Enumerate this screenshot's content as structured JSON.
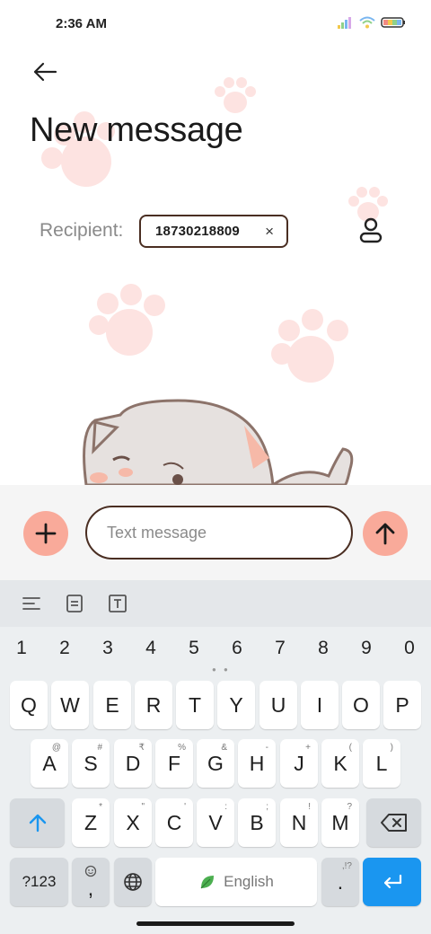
{
  "status": {
    "time": "2:36 AM"
  },
  "header": {
    "title": "New message"
  },
  "recipient": {
    "label": "Recipient:",
    "number": "18730218809",
    "remove": "×"
  },
  "compose": {
    "placeholder": "Text message"
  },
  "keyboard": {
    "numbers": [
      "1",
      "2",
      "3",
      "4",
      "5",
      "6",
      "7",
      "8",
      "9",
      "0"
    ],
    "row1": [
      "Q",
      "W",
      "E",
      "R",
      "T",
      "Y",
      "U",
      "I",
      "O",
      "P"
    ],
    "row2": [
      {
        "k": "A",
        "s": "@"
      },
      {
        "k": "S",
        "s": "#"
      },
      {
        "k": "D",
        "s": "₹"
      },
      {
        "k": "F",
        "s": "%"
      },
      {
        "k": "G",
        "s": "&"
      },
      {
        "k": "H",
        "s": "-"
      },
      {
        "k": "J",
        "s": "+"
      },
      {
        "k": "K",
        "s": "("
      },
      {
        "k": "L",
        "s": ")"
      }
    ],
    "row3": [
      {
        "k": "Z",
        "s": "*"
      },
      {
        "k": "X",
        "s": "\""
      },
      {
        "k": "C",
        "s": "'"
      },
      {
        "k": "V",
        "s": ":"
      },
      {
        "k": "B",
        "s": ";"
      },
      {
        "k": "N",
        "s": "!"
      },
      {
        "k": "M",
        "s": "?"
      }
    ],
    "symbols_label": "?123",
    "comma": ",",
    "space_label": "English",
    "period": ".",
    "period_sub": ",!?"
  },
  "colors": {
    "accent": "#f9aa9a",
    "border": "#4a2e22",
    "enter": "#1a96f0",
    "paw": "#fde3e1"
  }
}
